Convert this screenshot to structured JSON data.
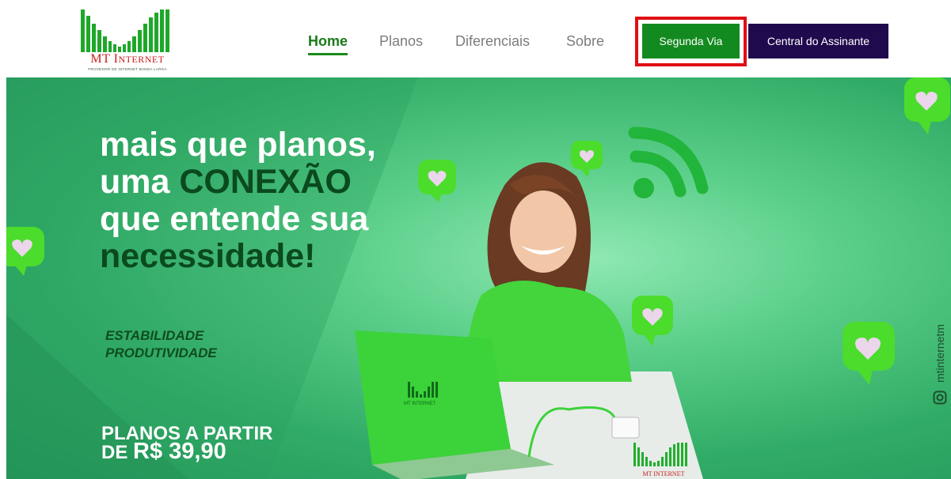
{
  "header": {
    "logo": {
      "brand_first": "MT",
      "brand_second_initial": "I",
      "brand_second_rest": "NTERNET",
      "tagline": "PROVEDOR DE INTERNET BANDA LARGA"
    },
    "nav": {
      "home": "Home",
      "planos": "Planos",
      "diferenciais": "Diferenciais",
      "sobre": "Sobre"
    },
    "buttons": {
      "segunda_via": "Segunda Via",
      "central": "Central do Assinante"
    }
  },
  "hero": {
    "headline": {
      "line1": "mais que planos,",
      "line2_prefix": "uma ",
      "line2_highlight": "CONEXÃO",
      "line3": "que entende sua",
      "line4": "necessidade!"
    },
    "features": [
      "ESTABILIDADE",
      "PRODUTIVIDADE"
    ],
    "price": {
      "line1": "PLANOS A PARTIR",
      "prefix": "DE ",
      "value": "R$ 39,90"
    },
    "social_handle": "mtinternetm",
    "laptop_logo": "MT INTERNET",
    "corner_logo": "MT INTERNET"
  },
  "colors": {
    "nav_active": "#1a7a1a",
    "segunda_via_bg": "#138a1f",
    "central_bg": "#200a4e",
    "highlight_border": "#e10d14",
    "hero_bg": "#31ac66"
  },
  "icons": [
    "heart-bubble-icon",
    "wifi-icon",
    "instagram-icon"
  ]
}
